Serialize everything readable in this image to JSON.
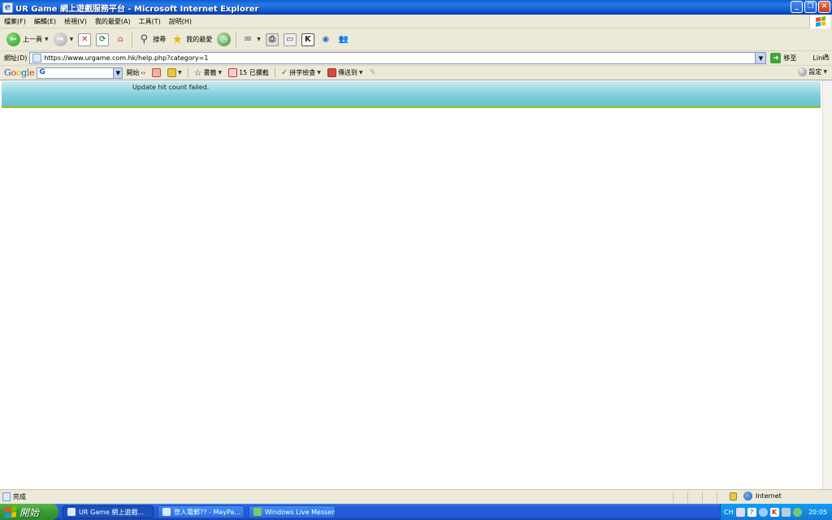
{
  "window": {
    "title": "UR Game 網上遊戲服務平台 - Microsoft Internet Explorer",
    "buttons": [
      "_",
      "❐",
      "✕"
    ]
  },
  "menubar": {
    "items": [
      "檔案(F)",
      "編輯(E)",
      "檢視(V)",
      "我的最愛(A)",
      "工具(T)",
      "說明(H)"
    ]
  },
  "toolbar": {
    "back_label": "上一頁",
    "search_label": "搜尋",
    "favorites_label": "我的最愛"
  },
  "address": {
    "label": "網址(D)",
    "url": "https://www.urgame.com.hk/help.php?category=1",
    "go_label": "移至",
    "links_label": "Links"
  },
  "google_toolbar": {
    "logo": "Google",
    "search_value": "G",
    "start_label": "開始",
    "bookmarks_label": "書籤",
    "blocked_label": "15 已攔截",
    "spellcheck_label": "拼字檢查",
    "sendto_label": "傳送到",
    "settings_label": "設定"
  },
  "page": {
    "message": "Update hit count failed."
  },
  "statusbar": {
    "status_text": "完成",
    "zone": "Internet"
  },
  "taskbar": {
    "start_label": "開始",
    "tasks": [
      "UR Game 網上遊戲...",
      "登入電郵?? - MayPa...",
      "Windows Live Messen..."
    ],
    "tray_text": "CH",
    "clock": "20:05"
  }
}
